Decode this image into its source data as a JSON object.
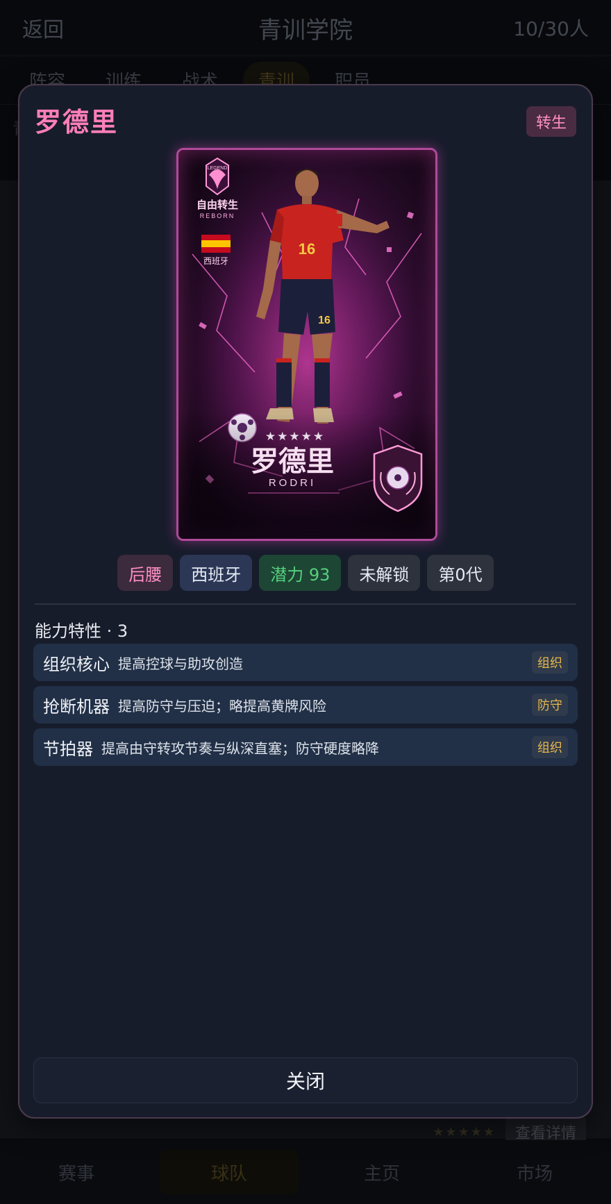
{
  "header": {
    "back": "返回",
    "title": "青训学院",
    "count": "10/30人"
  },
  "tabs": [
    {
      "label": "阵容"
    },
    {
      "label": "训练"
    },
    {
      "label": "战术"
    },
    {
      "label": "青训",
      "active": true
    },
    {
      "label": "职员"
    }
  ],
  "subbar": {
    "label": "青"
  },
  "background_list": {
    "stars": "★★★★★",
    "detail_button": "查看详情"
  },
  "bottom_nav": [
    {
      "label": "赛事"
    },
    {
      "label": "球队",
      "active": true
    },
    {
      "label": "主页"
    },
    {
      "label": "市场"
    }
  ],
  "modal": {
    "name": "罗德里",
    "reborn_badge": "转生",
    "card": {
      "emblem_small": "LEGEND",
      "edition": "自由转生",
      "edition_en": "REBORN",
      "nation": "西班牙",
      "shirt_number": "16",
      "stars": "★★★★★",
      "name_cn": "罗德里",
      "name_en": "RODRI"
    },
    "chips": {
      "position": "后腰",
      "nationality": "西班牙",
      "potential": "潜力 93",
      "lock_state": "未解锁",
      "generation": "第0代"
    },
    "traits_title": "能力特性 · 3",
    "traits": [
      {
        "name": "组织核心",
        "desc": "提高控球与助攻创造",
        "tag": "组织"
      },
      {
        "name": "抢断机器",
        "desc": "提高防守与压迫；略提高黄牌风险",
        "tag": "防守"
      },
      {
        "name": "节拍器",
        "desc": "提高由守转攻节奏与纵深直塞；防守硬度略降",
        "tag": "组织"
      }
    ],
    "close_label": "关闭"
  },
  "colors": {
    "accent_pink": "#ff7fb8",
    "modal_bg": "#171c2b",
    "trait_bg": "#213047",
    "potential_green": "#55d07e",
    "tag_gold": "#e7b84a"
  }
}
